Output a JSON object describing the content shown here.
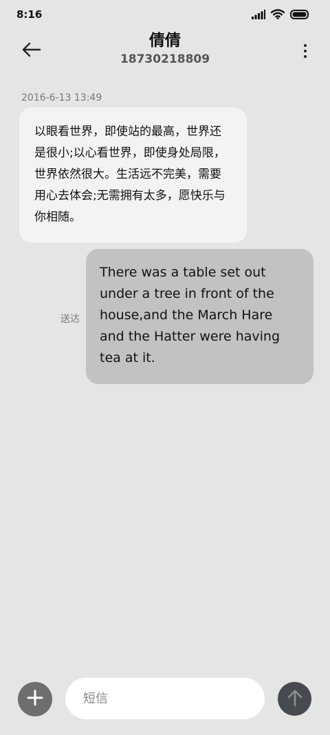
{
  "status_bar": {
    "time": "8:16",
    "icons": [
      "signal-icon",
      "wifi-icon",
      "battery-icon"
    ]
  },
  "header": {
    "back_icon": "back-arrow-icon",
    "contact_name": "倩倩",
    "contact_number": "18730218809",
    "more_icon": "more-vertical-icon"
  },
  "conversation": {
    "timestamp": "2016-6-13 13:49",
    "messages": [
      {
        "direction": "incoming",
        "text": "以眼看世界，即使站的最高，世界还是很小;以心看世界，即使身处局限，世界依然很大。生活远不完美，需要用心去体会;无需拥有太多，愿快乐与你相随。"
      },
      {
        "direction": "outgoing",
        "status": "送达",
        "text": "There was a table set out under a tree in front of the house,and the March Hare and the Hatter were having tea at it."
      }
    ]
  },
  "composer": {
    "add_icon": "plus-icon",
    "input_value": "",
    "input_placeholder": "短信",
    "send_icon": "arrow-up-icon"
  },
  "colors": {
    "background": "#e5e5e5",
    "incoming_bubble": "#f3f3f3",
    "outgoing_bubble": "#c2c2c2",
    "send_button": "#474a4e",
    "add_button": "#6e6e6e"
  }
}
